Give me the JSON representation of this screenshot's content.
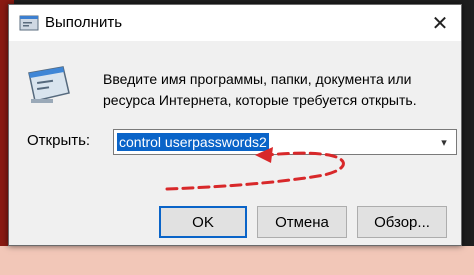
{
  "window": {
    "title": "Выполнить",
    "title_icon": "run-icon",
    "close_icon": "close-icon"
  },
  "body": {
    "icon": "run-app-icon",
    "description": "Введите имя программы, папки, документа или ресурса Интернета, которые требуется открыть."
  },
  "open_field": {
    "label": "Открыть:",
    "value": "control userpasswords2",
    "dropdown_icon": "chevron-down-icon"
  },
  "buttons": {
    "ok": "OK",
    "cancel": "Отмена",
    "browse": "Обзор..."
  },
  "colors": {
    "selection": "#0a64c8",
    "annotation_arrow": "#d8282a"
  }
}
